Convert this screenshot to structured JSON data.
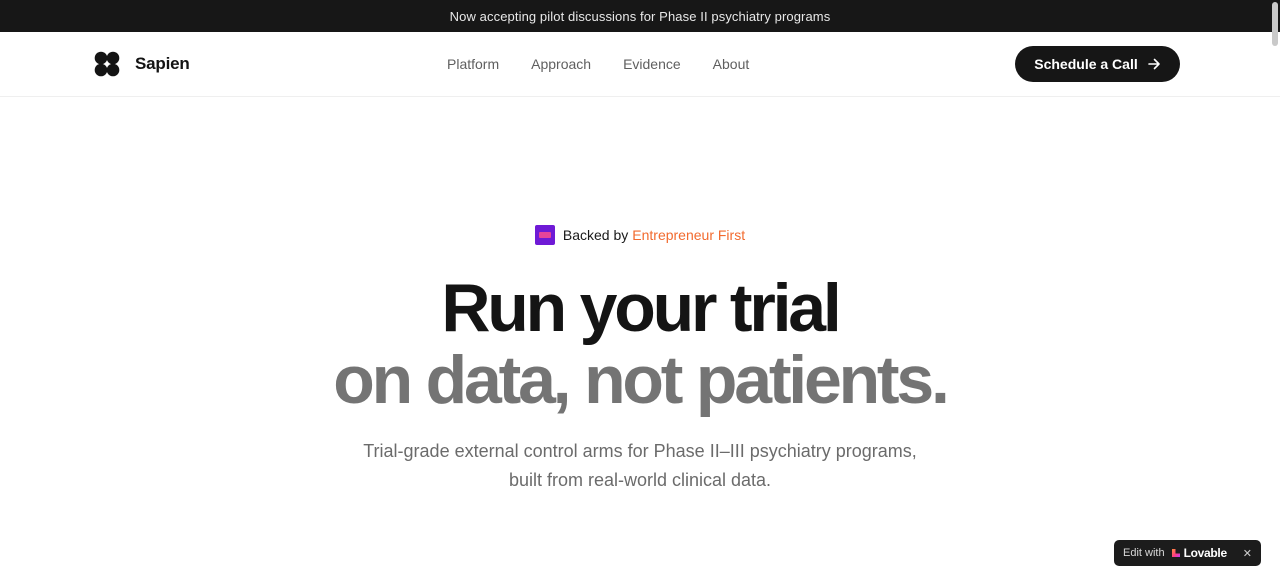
{
  "announcement": {
    "text": "Now accepting pilot discussions for Phase II psychiatry programs"
  },
  "header": {
    "brand": {
      "name": "Sapien",
      "logo_icon": "four-circle-logo-icon"
    },
    "nav": [
      {
        "label": "Platform"
      },
      {
        "label": "Approach"
      },
      {
        "label": "Evidence"
      },
      {
        "label": "About"
      }
    ],
    "cta": {
      "label": "Schedule a Call",
      "icon": "arrow-right-icon"
    }
  },
  "hero": {
    "backed_prefix": "Backed by",
    "backed_accent": "Entrepreneur First",
    "title_line1": "Run your trial",
    "title_line2": "on data, not patients.",
    "subtitle_line1": "Trial-grade external control arms for Phase II–III psychiatry programs,",
    "subtitle_line2": "built from real-world clinical data."
  },
  "badge": {
    "prefix": "Edit with",
    "brand": "Lovable",
    "close": "✕"
  },
  "colors": {
    "announcement_bg": "#171717",
    "cta_bg": "#161616",
    "accent_orange": "#f26a2e",
    "ef_purple": "#6f1ad6",
    "title_dark": "#141414",
    "title_gray": "#747474"
  }
}
